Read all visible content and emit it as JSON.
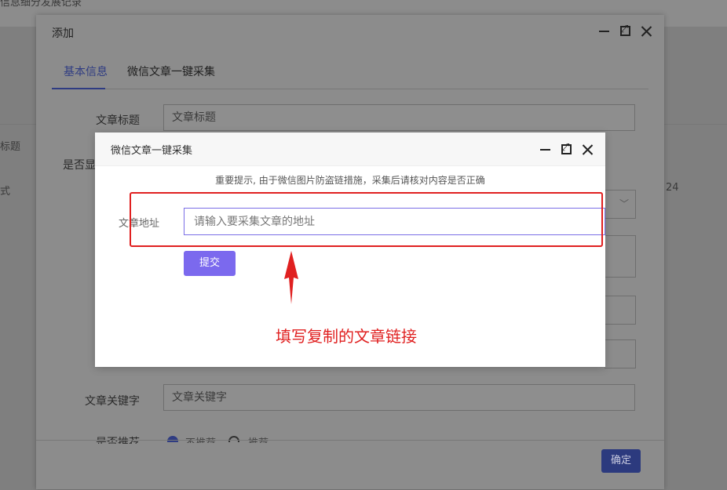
{
  "background": {
    "top_fragment": "信息细分发展记录",
    "left_label_1": "标题",
    "left_label_2": "式",
    "right_number": "24"
  },
  "outer_dialog": {
    "title": "添加",
    "tabs": [
      {
        "label": "基本信息",
        "active": true
      },
      {
        "label": "微信文章一键采集",
        "active": false
      }
    ],
    "fields": {
      "title_label": "文章标题",
      "title_placeholder": "文章标题",
      "show_label": "是否显",
      "keyword_label": "文章关键字",
      "keyword_placeholder": "文章关键字",
      "recommend_label": "是否推荐",
      "recommend_options": [
        "不推荐",
        "推荐"
      ]
    },
    "confirm_label": "确定"
  },
  "inner_dialog": {
    "title": "微信文章一键采集",
    "tip": "重要提示, 由于微信图片防盗链措施，采集后请核对内容是否正确",
    "address_label": "文章地址",
    "address_placeholder": "请输入要采集文章的地址",
    "submit_label": "提交"
  },
  "annotation": {
    "text": "填写复制的文章链接",
    "color": "#e02020"
  },
  "colors": {
    "primary": "#7b69ee",
    "tab_active": "#2f3c82"
  }
}
